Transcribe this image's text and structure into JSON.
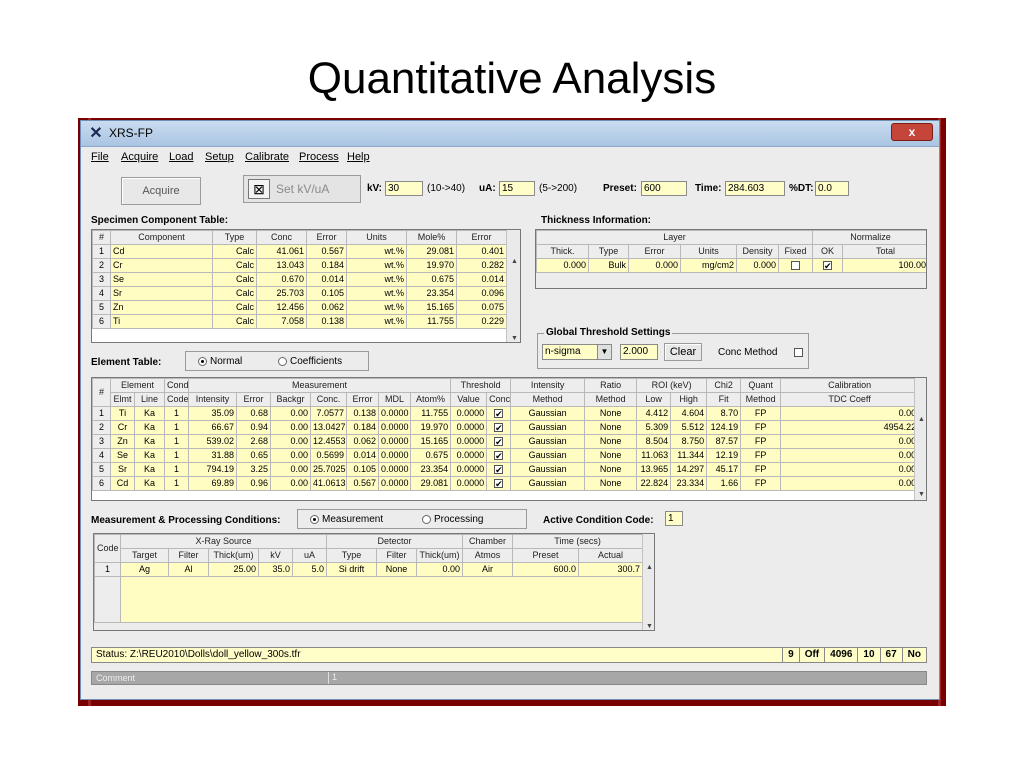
{
  "slide_title": "Quantitative Analysis",
  "window": {
    "title": "XRS-FP",
    "icon": "xrs-logo-icon",
    "close": "x"
  },
  "menu": [
    "File",
    "Acquire",
    "Load",
    "Setup",
    "Calibrate",
    "Process",
    "Help"
  ],
  "toolbar": {
    "acquire": "Acquire",
    "setkv": "Set kV/uA",
    "kv_label": "kV:",
    "kv_value": "30",
    "kv_range": "(10->40)",
    "ua_label": "uA:",
    "ua_value": "15",
    "ua_range": "(5->200)",
    "preset_label": "Preset:",
    "preset_value": "600",
    "time_label": "Time:",
    "time_value": "284.603",
    "dt_label": "%DT:",
    "dt_value": "0.0"
  },
  "specimen": {
    "title": "Specimen Component Table:",
    "headers": [
      "#",
      "Component",
      "Type",
      "Conc",
      "Error",
      "Units",
      "Mole%",
      "Error"
    ],
    "rows": [
      [
        "1",
        "Cd",
        "Calc",
        "41.061",
        "0.567",
        "wt.%",
        "29.081",
        "0.401"
      ],
      [
        "2",
        "Cr",
        "Calc",
        "13.043",
        "0.184",
        "wt.%",
        "19.970",
        "0.282"
      ],
      [
        "3",
        "Se",
        "Calc",
        "0.670",
        "0.014",
        "wt.%",
        "0.675",
        "0.014"
      ],
      [
        "4",
        "Sr",
        "Calc",
        "25.703",
        "0.105",
        "wt.%",
        "23.354",
        "0.096"
      ],
      [
        "5",
        "Zn",
        "Calc",
        "12.456",
        "0.062",
        "wt.%",
        "15.165",
        "0.075"
      ],
      [
        "6",
        "Ti",
        "Calc",
        "7.058",
        "0.138",
        "wt.%",
        "11.755",
        "0.229"
      ]
    ]
  },
  "thickness": {
    "title": "Thickness Information:",
    "group_layer": "Layer",
    "group_normalize": "Normalize",
    "headers": [
      "Thick.",
      "Type",
      "Error",
      "Units",
      "Density",
      "Fixed",
      "OK",
      "Total"
    ],
    "row": [
      "0.000",
      "Bulk",
      "0.000",
      "mg/cm2",
      "0.000",
      "",
      "✔",
      "100.00"
    ]
  },
  "threshold": {
    "title": "Global Threshold Settings",
    "select": "n-sigma",
    "value": "2.000",
    "clear": "Clear",
    "conc_method": "Conc Method"
  },
  "element_table": {
    "label": "Element Table:",
    "opt_normal": "Normal",
    "opt_coeff": "Coefficients",
    "group_headers": [
      "#",
      "Element",
      "Cond",
      "Measurement",
      "Threshold",
      "Intensity",
      "Ratio",
      "ROI (keV)",
      "Chi2",
      "Quant",
      "Calibration"
    ],
    "headers": [
      "Elmt",
      "Line",
      "Code",
      "Intensity",
      "Error",
      "Backgr",
      "Conc.",
      "Error",
      "MDL",
      "Atom%",
      "Value",
      "Conc",
      "Method",
      "Method",
      "Low",
      "High",
      "Fit",
      "Method",
      "TDC Coeff"
    ],
    "rows": [
      [
        "1",
        "Ti",
        "Ka",
        "1",
        "35.09",
        "0.68",
        "0.00",
        "7.0577",
        "0.138",
        "0.0000",
        "11.755",
        "0.0000",
        "✔",
        "Gaussian",
        "None",
        "4.412",
        "4.604",
        "8.70",
        "FP",
        "0.00"
      ],
      [
        "2",
        "Cr",
        "Ka",
        "1",
        "66.67",
        "0.94",
        "0.00",
        "13.0427",
        "0.184",
        "0.0000",
        "19.970",
        "0.0000",
        "✔",
        "Gaussian",
        "None",
        "5.309",
        "5.512",
        "124.19",
        "FP",
        "4954.22"
      ],
      [
        "3",
        "Zn",
        "Ka",
        "1",
        "539.02",
        "2.68",
        "0.00",
        "12.4553",
        "0.062",
        "0.0000",
        "15.165",
        "0.0000",
        "✔",
        "Gaussian",
        "None",
        "8.504",
        "8.750",
        "87.57",
        "FP",
        "0.00"
      ],
      [
        "4",
        "Se",
        "Ka",
        "1",
        "31.88",
        "0.65",
        "0.00",
        "0.5699",
        "0.014",
        "0.0000",
        "0.675",
        "0.0000",
        "✔",
        "Gaussian",
        "None",
        "11.063",
        "11.344",
        "12.19",
        "FP",
        "0.00"
      ],
      [
        "5",
        "Sr",
        "Ka",
        "1",
        "794.19",
        "3.25",
        "0.00",
        "25.7025",
        "0.105",
        "0.0000",
        "23.354",
        "0.0000",
        "✔",
        "Gaussian",
        "None",
        "13.965",
        "14.297",
        "45.17",
        "FP",
        "0.00"
      ],
      [
        "6",
        "Cd",
        "Ka",
        "1",
        "69.89",
        "0.96",
        "0.00",
        "41.0613",
        "0.567",
        "0.0000",
        "29.081",
        "0.0000",
        "✔",
        "Gaussian",
        "None",
        "22.824",
        "23.334",
        "1.66",
        "FP",
        "0.00"
      ]
    ]
  },
  "conditions": {
    "label": "Measurement & Processing Conditions:",
    "opt_measurement": "Measurement",
    "opt_processing": "Processing",
    "active_label": "Active Condition Code:",
    "active_value": "1",
    "group_headers": [
      "Code",
      "X-Ray Source",
      "Detector",
      "Chamber",
      "Time (secs)"
    ],
    "headers": [
      "Target",
      "Filter",
      "Thick(um)",
      "kV",
      "uA",
      "Type",
      "Filter",
      "Thick(um)",
      "Atmos",
      "Preset",
      "Actual"
    ],
    "row": [
      "1",
      "Ag",
      "Al",
      "25.00",
      "35.0",
      "5.0",
      "Si drift",
      "None",
      "0.00",
      "Air",
      "600.0",
      "300.7"
    ]
  },
  "status": {
    "text": "Status: Z:\\REU2010\\Dolls\\doll_yellow_300s.tfr",
    "cells": [
      "9",
      "Off",
      "4096",
      "10",
      "67",
      "No"
    ]
  },
  "comment": {
    "label": "Comment",
    "value": "1"
  }
}
